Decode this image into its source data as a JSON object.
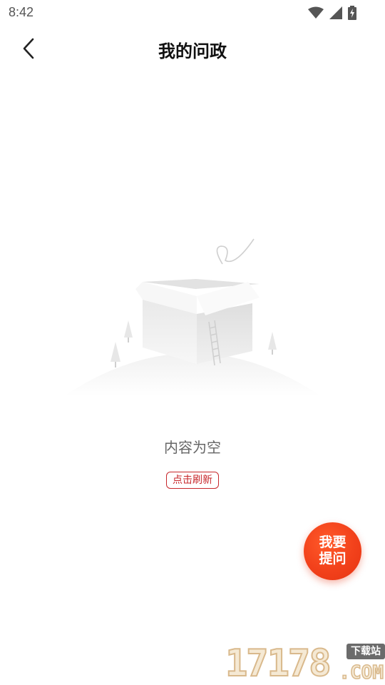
{
  "status_bar": {
    "time": "8:42",
    "icons": [
      "wifi-icon",
      "signal-icon",
      "battery-charging-icon"
    ]
  },
  "header": {
    "title": "我的问政",
    "back_icon": "chevron-left-icon"
  },
  "empty_state": {
    "illustration": "empty-box-icon",
    "message": "内容为空",
    "refresh_label": "点击刷新"
  },
  "fab": {
    "line1": "我要",
    "line2": "提问",
    "color": "#f2411b"
  },
  "watermark": {
    "digits": "17178",
    "tag": "下载站",
    "suffix": ".COM"
  },
  "colors": {
    "accent": "#c7272b",
    "fab": "#f2411b",
    "text_secondary": "#666666"
  }
}
